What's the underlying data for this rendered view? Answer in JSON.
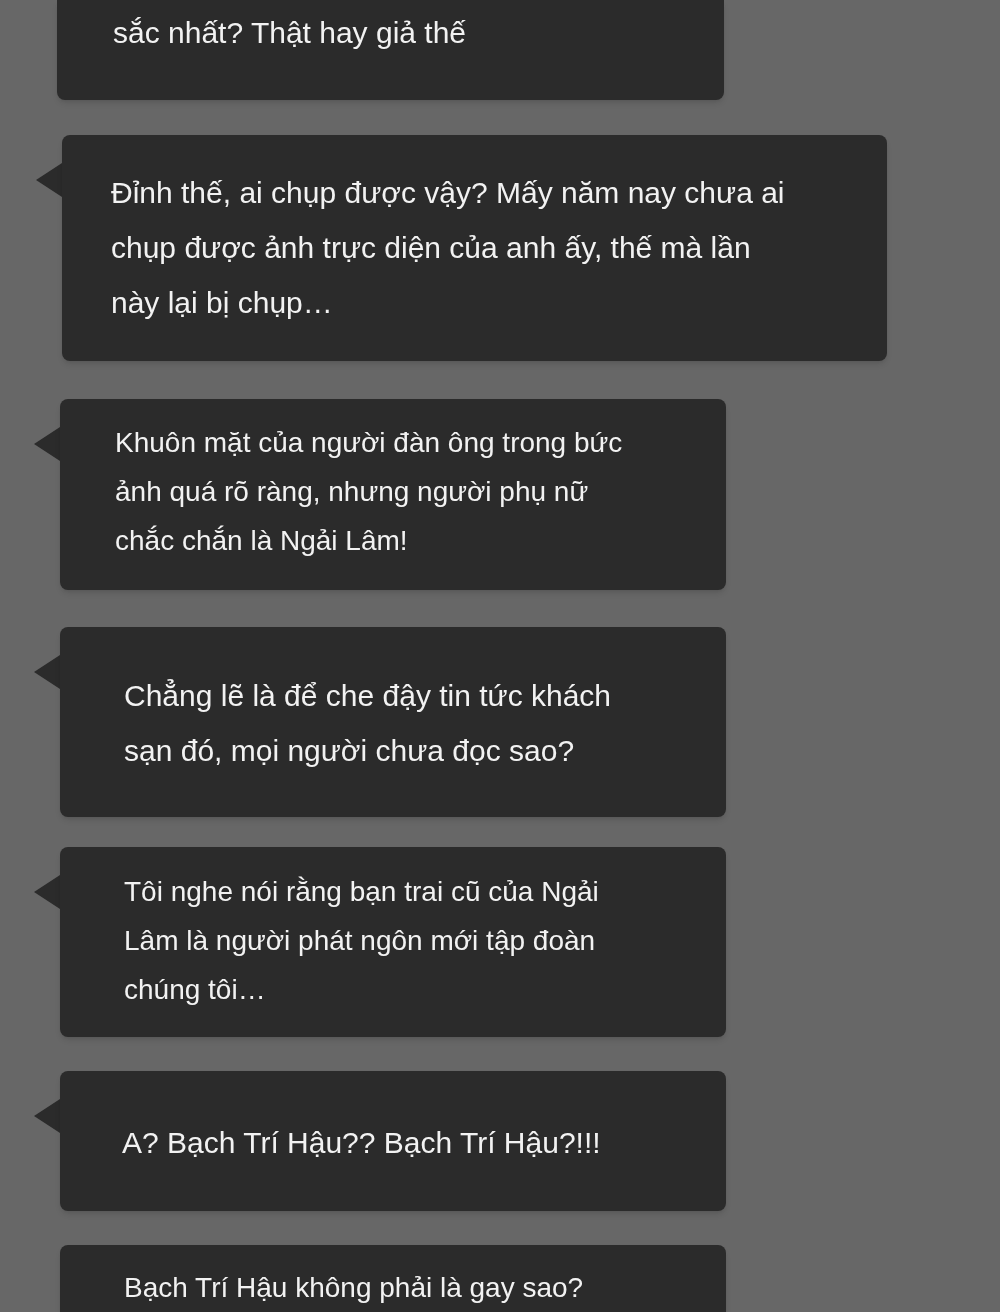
{
  "messages": [
    {
      "lines": [
        "sắc nhất? Thật hay giả thế"
      ]
    },
    {
      "lines": [
        "Đỉnh thế, ai chụp được vậy? Mấy năm nay chưa ai",
        "chụp được ảnh trực diện của anh ấy, thế mà lần",
        "này lại bị chụp…"
      ]
    },
    {
      "lines": [
        "Khuôn mặt của người đàn ông trong bức",
        "ảnh quá rõ ràng, nhưng người phụ nữ",
        "chắc chắn là Ngải Lâm!"
      ]
    },
    {
      "lines": [
        "Chẳng lẽ là để che đậy tin tức khách",
        "sạn đó, mọi người chưa đọc sao?"
      ]
    },
    {
      "lines": [
        "Tôi nghe nói rằng bạn trai cũ của Ngải",
        "Lâm là người phát ngôn mới tập đoàn",
        "chúng tôi…"
      ]
    },
    {
      "lines": [
        "A? Bạch Trí Hậu?? Bạch Trí Hậu?!!!"
      ]
    },
    {
      "lines": [
        "Bạch Trí Hậu không phải là gay sao?"
      ]
    }
  ]
}
